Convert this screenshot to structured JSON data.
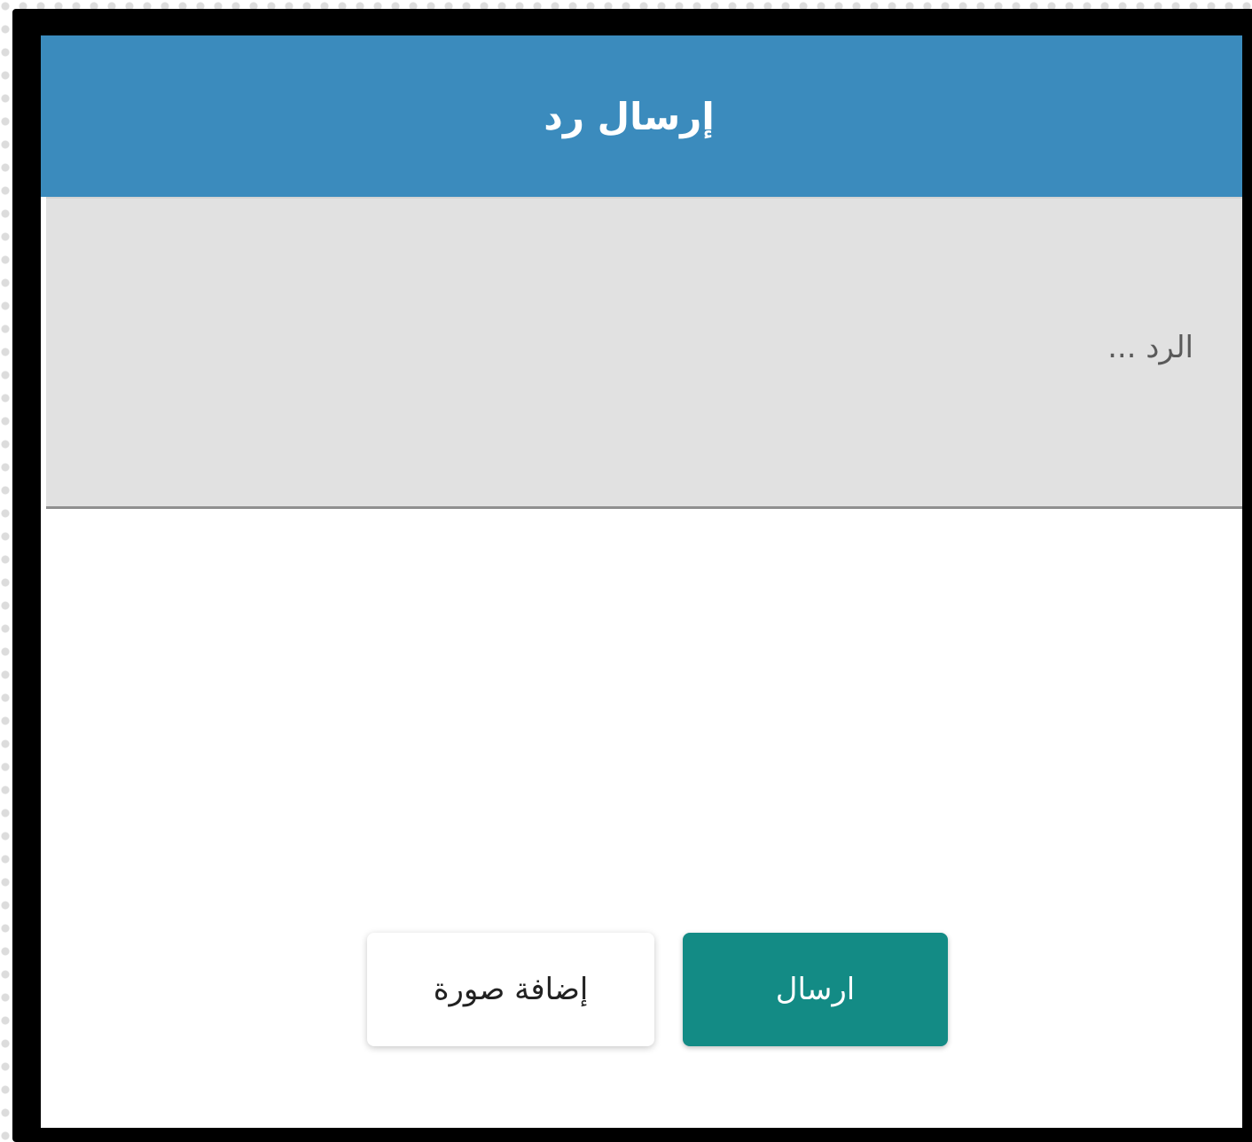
{
  "modal": {
    "title": "إرسال رد",
    "reply_placeholder": "الرد ...",
    "reply_value": "",
    "buttons": {
      "add_image_label": "إضافة صورة",
      "send_label": "ارسال"
    }
  },
  "colors": {
    "header_bg": "#3b8bbd",
    "send_button_bg": "#138b85",
    "input_bg": "#e1e1e1",
    "frame": "#000000"
  }
}
